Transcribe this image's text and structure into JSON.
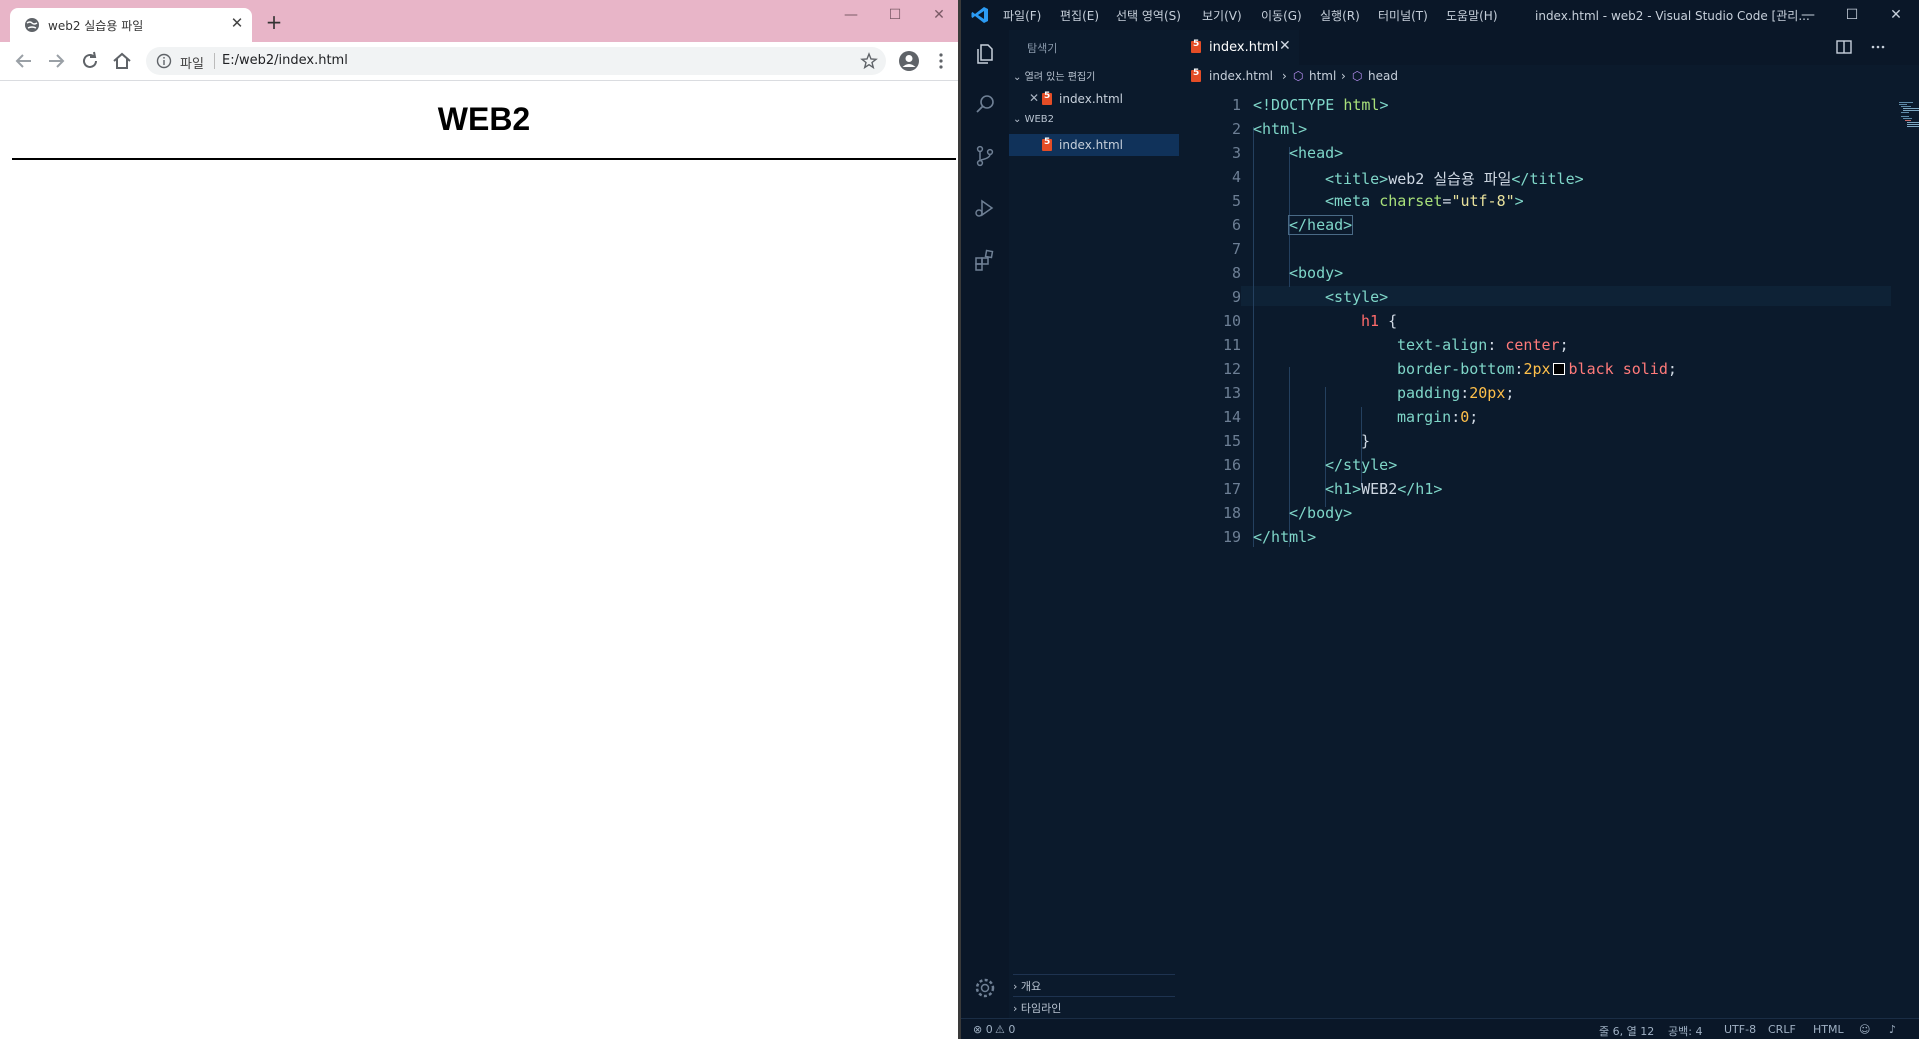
{
  "browser": {
    "tab": {
      "title": "web2 실습용 파일"
    },
    "new_tab": "+",
    "window_controls": {
      "minimize": "—",
      "maximize": "☐",
      "close": "✕"
    },
    "address": {
      "scheme_label": "파일",
      "url": "E:/web2/index.html"
    },
    "page": {
      "h1": "WEB2"
    }
  },
  "vscode": {
    "menu": [
      "파일(F)",
      "편집(E)",
      "선택 영역(S)",
      "보기(V)",
      "이동(G)",
      "실행(R)",
      "터미널(T)",
      "도움말(H)"
    ],
    "window_title": "index.html - web2 - Visual Studio Code [관리...",
    "window_controls": {
      "minimize": "—",
      "maximize": "☐",
      "close": "✕"
    },
    "sidebar": {
      "title": "탐색기",
      "open_editors_label": "열려 있는 편집기",
      "open_editors": [
        {
          "name": "index.html"
        }
      ],
      "folder_label": "WEB2",
      "files": [
        {
          "name": "index.html"
        }
      ],
      "outline_label": "개요",
      "timeline_label": "타임라인"
    },
    "editor": {
      "active_tab": "index.html",
      "breadcrumb": [
        "index.html",
        "html",
        "head"
      ],
      "line_numbers": [
        "1",
        "2",
        "3",
        "4",
        "5",
        "6",
        "7",
        "8",
        "9",
        "10",
        "11",
        "12",
        "13",
        "14",
        "15",
        "16",
        "17",
        "18",
        "19"
      ],
      "lines": {
        "l1a": "<!DOCTYPE ",
        "l1b": "html",
        "l1c": ">",
        "l2": "<html>",
        "l3": "<head>",
        "l4a": "<title>",
        "l4b": "web2 실습용 파일",
        "l4c": "</title>",
        "l5a": "<meta ",
        "l5b": "charset",
        "l5c": "=",
        "l5d": "\"utf-8\"",
        "l5e": ">",
        "l6": "</head>",
        "l8": "<body>",
        "l9": "<style>",
        "l10a": "h1",
        "l10b": " {",
        "l11a": "text-align",
        "l11b": ": ",
        "l11c": "center",
        "l11d": ";",
        "l12a": "border-bottom",
        "l12b": ":",
        "l12c": "2px",
        "l12d": "black",
        "l12e": " solid",
        "l12f": ";",
        "l13a": "padding",
        "l13b": ":",
        "l13c": "20px",
        "l13d": ";",
        "l14a": "margin",
        "l14b": ":",
        "l14c": "0",
        "l14d": ";",
        "l15": "}",
        "l16": "</style>",
        "l17a": "<h1>",
        "l17b": "WEB2",
        "l17c": "</h1>",
        "l18": "</body>",
        "l19": "</html>"
      }
    },
    "status": {
      "errors": "⊗ 0",
      "warnings": "⚠ 0",
      "position": "줄 6, 열 12",
      "spaces": "공백: 4",
      "encoding": "UTF-8",
      "eol": "CRLF",
      "language": "HTML"
    },
    "colors": {
      "background": "#0b1a2c",
      "tag": "#7fd6c8",
      "attribute": "#a8e07a",
      "string": "#e8e19c",
      "selector": "#ff6b6b",
      "number": "#ffc04a"
    }
  }
}
